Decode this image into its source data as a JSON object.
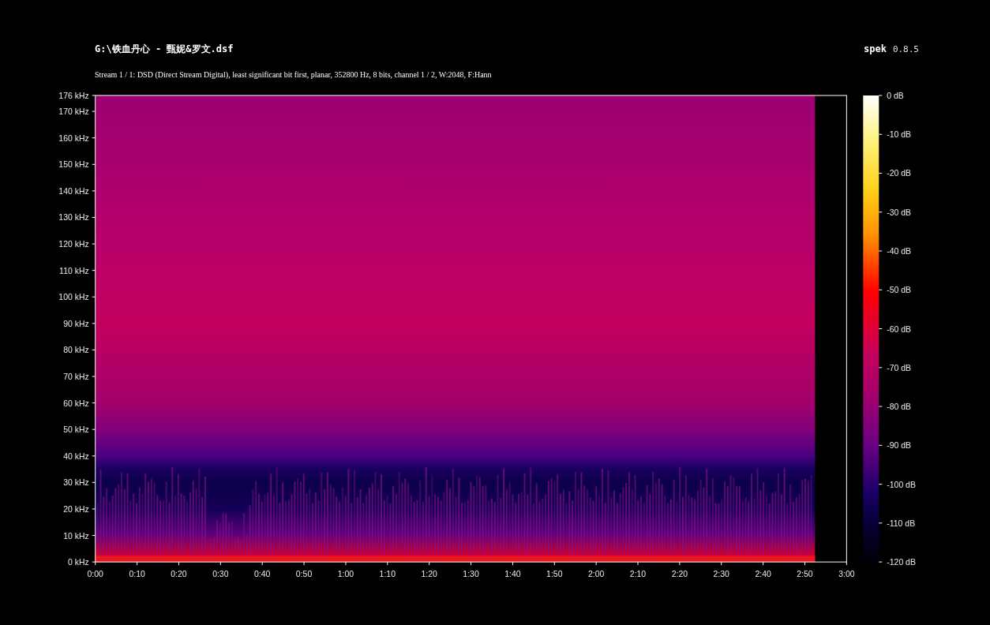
{
  "header": {
    "title": "G:\\铁血丹心 - 甄妮&罗文.dsf",
    "app_name": "spek",
    "version": "0.8.5",
    "stream_info": "Stream 1 / 1: DSD (Direct Stream Digital), least significant bit first, planar, 352800 Hz, 8 bits, channel 1 / 2, W:2048, F:Hann"
  },
  "spectrogram": {
    "frequency_ticks": [
      "176 kHz",
      "170 kHz",
      "160 kHz",
      "150 kHz",
      "140 kHz",
      "130 kHz",
      "120 kHz",
      "110 kHz",
      "100 kHz",
      "90 kHz",
      "80 kHz",
      "70 kHz",
      "60 kHz",
      "50 kHz",
      "40 kHz",
      "30 kHz",
      "20 kHz",
      "10 kHz",
      "0 kHz"
    ],
    "time_ticks": [
      "0:00",
      "0:10",
      "0:20",
      "0:30",
      "0:40",
      "0:50",
      "1:00",
      "1:10",
      "1:20",
      "1:30",
      "1:40",
      "1:50",
      "2:00",
      "2:10",
      "2:20",
      "2:30",
      "2:40",
      "2:50",
      "3:00"
    ]
  },
  "color_scale": {
    "ticks": [
      "0 dB",
      "-10 dB",
      "-20 dB",
      "-30 dB",
      "-40 dB",
      "-50 dB",
      "-60 dB",
      "-70 dB",
      "-80 dB",
      "-90 dB",
      "-100 dB",
      "-110 dB",
      "-120 dB"
    ]
  }
}
